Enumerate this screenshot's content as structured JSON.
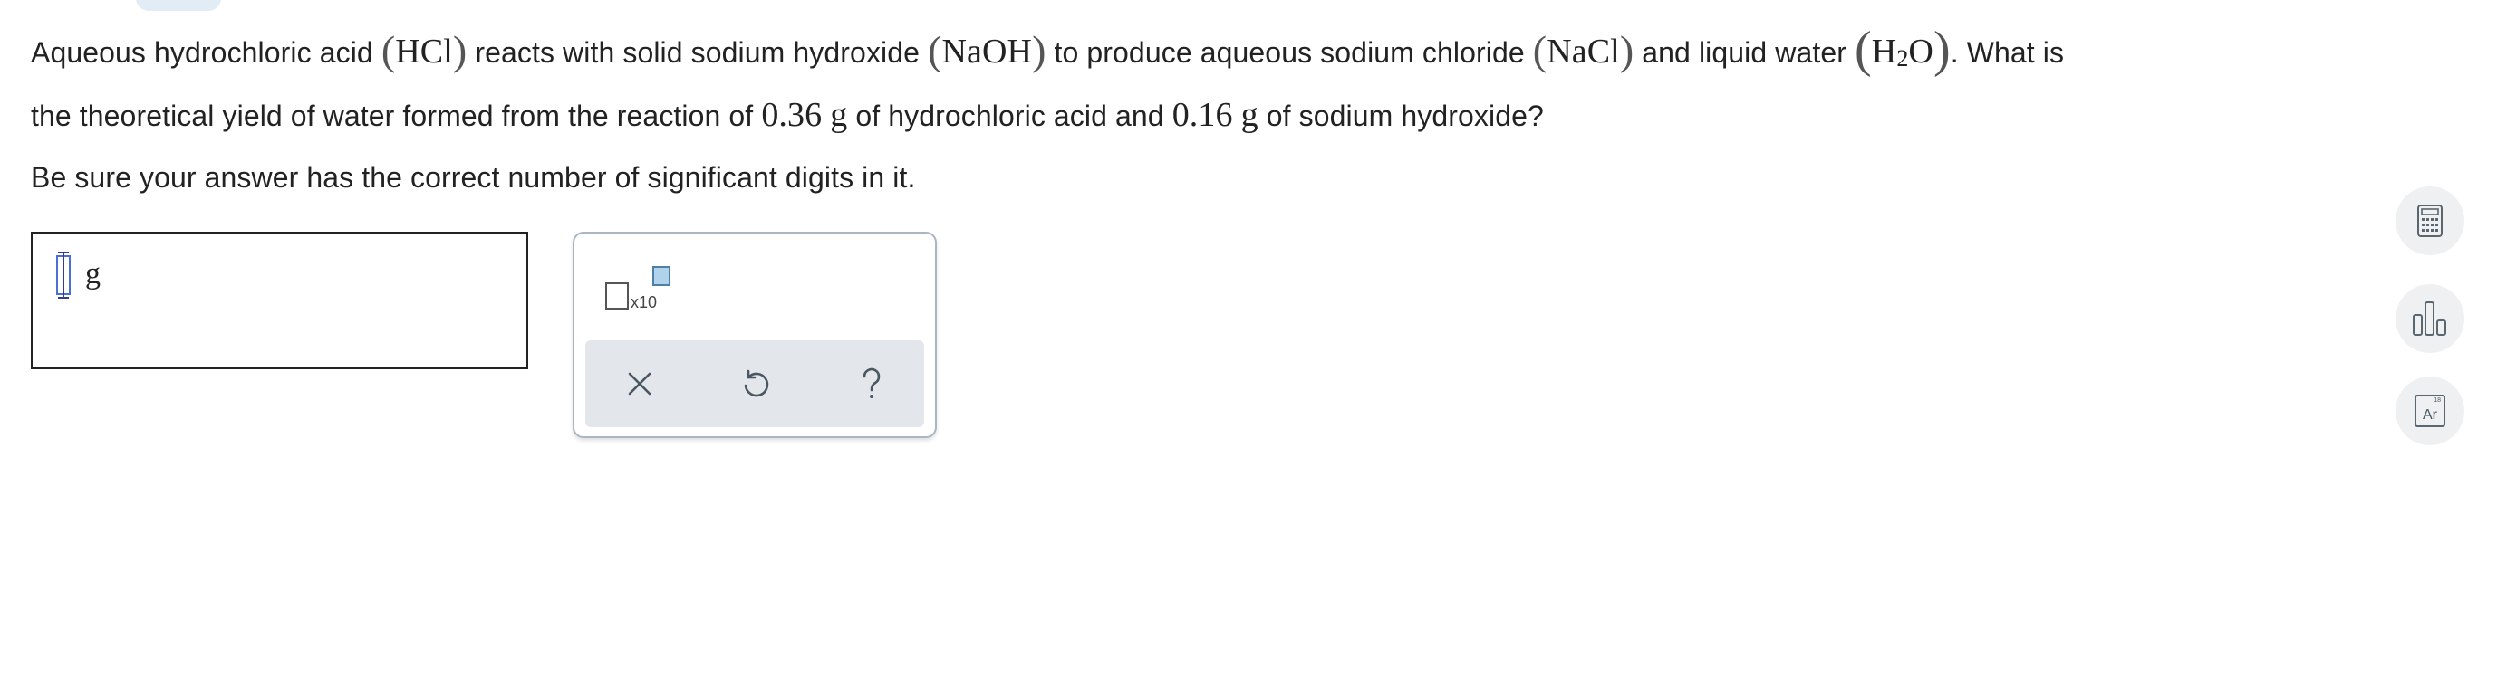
{
  "question": {
    "s1_a": "Aqueous hydrochloric acid",
    "hcl": "HCl",
    "s1_b": "reacts with solid sodium hydroxide",
    "naoh": "NaOH",
    "s1_c": "to produce aqueous sodium chloride",
    "nacl": "NaCl",
    "s1_d": "and liquid water",
    "h": "H",
    "h_sub": "2",
    "o": "O",
    "s1_e": ". What is",
    "s2_a": "the theoretical yield of water formed from the reaction of",
    "mass1": "0.36",
    "mass1_unit": "g",
    "s2_b": "of hydrochloric acid and",
    "mass2": "0.16",
    "mass2_unit": "g",
    "s2_c": "of sodium hydroxide?",
    "instruction": "Be sure your answer has the correct number of significant digits in it."
  },
  "answer": {
    "value": "",
    "unit": "g"
  },
  "tools": {
    "sci_label": "x10",
    "ptable_number": "18",
    "ptable_symbol": "Ar"
  },
  "icons": {
    "sci_notation": "scientific-notation-icon",
    "clear": "x-icon",
    "undo": "undo-icon",
    "help": "question-mark-icon",
    "calculator": "calculator-icon",
    "chart": "bar-chart-icon",
    "periodic_table": "periodic-table-icon"
  },
  "colors": {
    "cursor_frame": "#4a6fd6",
    "panel_border": "#a9b7c2",
    "action_bar": "#e3e7eb",
    "exponent_fill": "#aed3ea"
  }
}
